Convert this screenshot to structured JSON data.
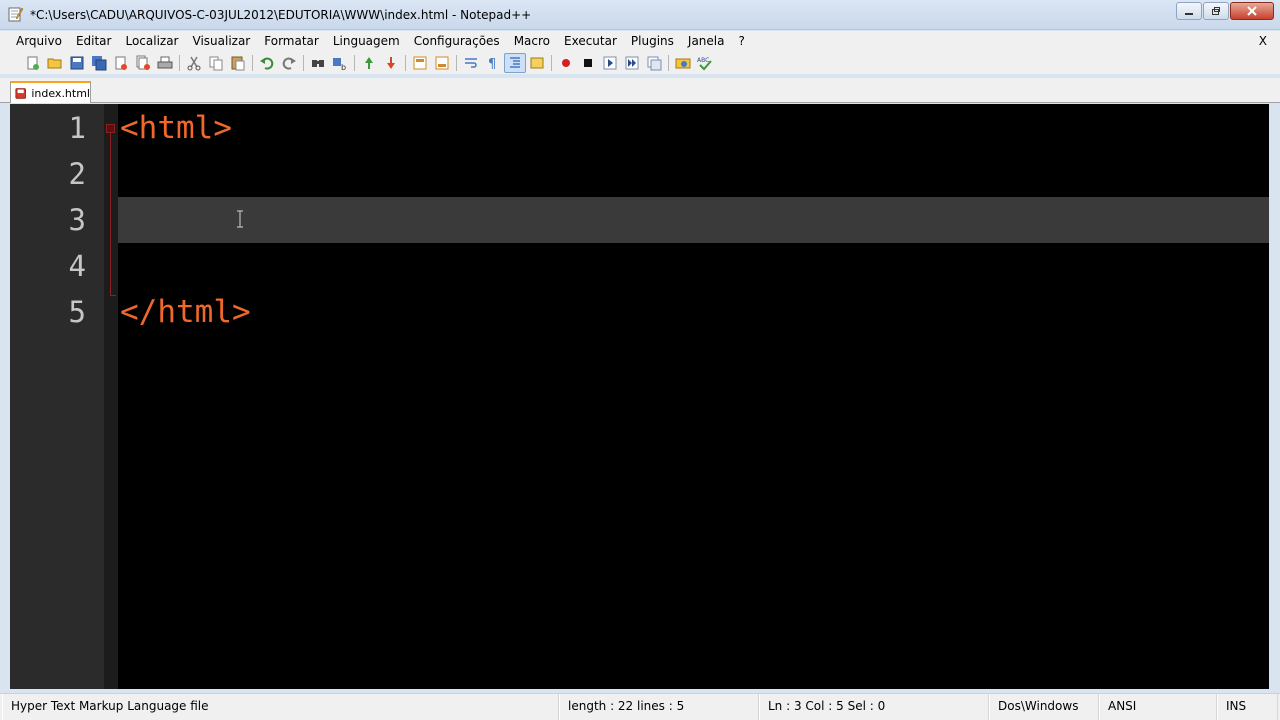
{
  "window": {
    "title": "*C:\\Users\\CADU\\ARQUIVOS-C-03JUL2012\\EDUTORIA\\WWW\\index.html - Notepad++"
  },
  "menu": {
    "items": [
      "Arquivo",
      "Editar",
      "Localizar",
      "Visualizar",
      "Formatar",
      "Linguagem",
      "Configurações",
      "Macro",
      "Executar",
      "Plugins",
      "Janela",
      "?"
    ],
    "close_label": "X"
  },
  "toolbar": {
    "icons": [
      "new-file-icon",
      "open-file-icon",
      "save-icon",
      "save-all-icon",
      "close-icon",
      "close-all-icon",
      "print-icon",
      "cut-icon",
      "copy-icon",
      "paste-icon",
      "undo-icon",
      "redo-icon",
      "find-icon",
      "replace-icon",
      "zoom-in-icon",
      "zoom-out-icon",
      "sync-vertical-icon",
      "sync-horizontal-icon",
      "word-wrap-icon",
      "show-all-chars-icon",
      "indent-guide-icon",
      "user-lang-icon",
      "record-macro-icon",
      "stop-record-icon",
      "play-macro-icon",
      "run-macro-multiple-icon",
      "save-macro-icon",
      "launch-browser-icon",
      "spell-check-icon"
    ]
  },
  "tab": {
    "label": "index.html"
  },
  "editor": {
    "line_numbers": [
      "1",
      "2",
      "3",
      "4",
      "5"
    ],
    "lines": [
      "<html>",
      "",
      "",
      "",
      "</html>"
    ],
    "current_line": 3,
    "text_color": "#f0682a",
    "background": "#000000",
    "gutter_background": "#2b2b2b",
    "current_line_background": "#3a3a3a"
  },
  "statusbar": {
    "file_type": "Hyper Text Markup Language file",
    "length_lines": "length : 22    lines : 5",
    "position": "Ln : 3    Col : 5    Sel : 0",
    "eol": "Dos\\Windows",
    "encoding": "ANSI",
    "mode": "INS"
  }
}
